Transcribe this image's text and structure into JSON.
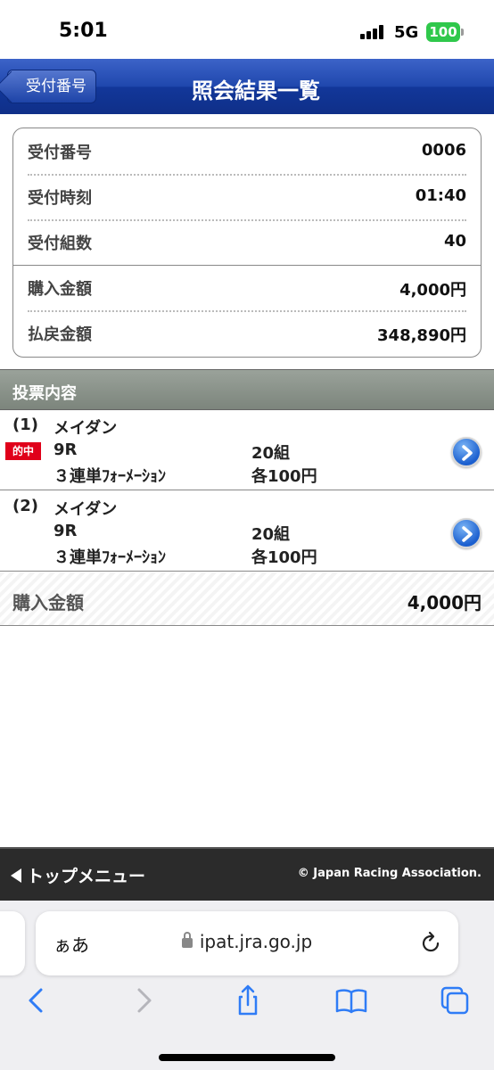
{
  "status_bar": {
    "time": "5:01",
    "network": "5G",
    "battery": "100"
  },
  "nav": {
    "back_label": "受付番号",
    "title": "照会結果一覧"
  },
  "summary": {
    "rows": [
      {
        "label": "受付番号",
        "value": "0006"
      },
      {
        "label": "受付時刻",
        "value": "01:40"
      },
      {
        "label": "受付組数",
        "value": "40"
      },
      {
        "label": "購入金額",
        "value": "4,000円"
      },
      {
        "label": "払戻金額",
        "value": "348,890円"
      }
    ]
  },
  "bets_section": {
    "title": "投票内容"
  },
  "bets": [
    {
      "index": "(1)",
      "race": "メイダン",
      "round": "9R",
      "bet_type": "３連単ﾌｫｰﾒｰｼｮﾝ",
      "combos": "20組",
      "unit": "各100円",
      "badge": "的中"
    },
    {
      "index": "(2)",
      "race": "メイダン",
      "round": "9R",
      "bet_type": "３連単ﾌｫｰﾒｰｼｮﾝ",
      "combos": "20組",
      "unit": "各100円"
    }
  ],
  "total": {
    "label": "購入金額",
    "value": "4,000円"
  },
  "footer": {
    "top_menu": "トップメニュー",
    "copyright": "© Japan Racing Association."
  },
  "browser": {
    "text_size": "ぁあ",
    "url": "ipat.jra.go.jp"
  },
  "colors": {
    "header_blue": "#1f47ad",
    "hit_red": "#e0001a",
    "section_gray": "#8a928a",
    "footer_dark": "#2b2b2b",
    "ios_blue": "#2f7cf6"
  }
}
